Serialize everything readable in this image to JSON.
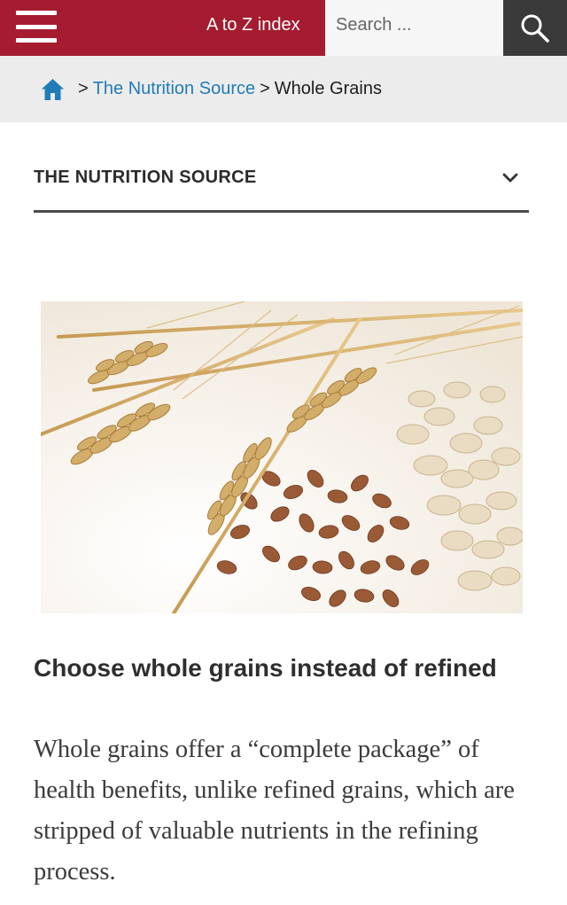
{
  "header": {
    "atoz_label": "A to Z index",
    "search_placeholder": "Search ...",
    "brand_color": "#a51c30"
  },
  "breadcrumb": {
    "home_icon": "home-icon",
    "separator": ">",
    "parent": "The Nutrition Source",
    "current": "Whole Grains",
    "link_color": "#1f7cb6"
  },
  "section": {
    "title": "THE NUTRITION SOURCE",
    "toggle_icon": "chevron-down-icon"
  },
  "image": {
    "subject": "wheat-grains-oats-photo"
  },
  "content": {
    "heading": "Choose whole grains instead of refined",
    "paragraph": "Whole grains offer a “complete package” of health benefits, unlike refined grains, which are stripped of valuable nutrients in the refining process."
  }
}
